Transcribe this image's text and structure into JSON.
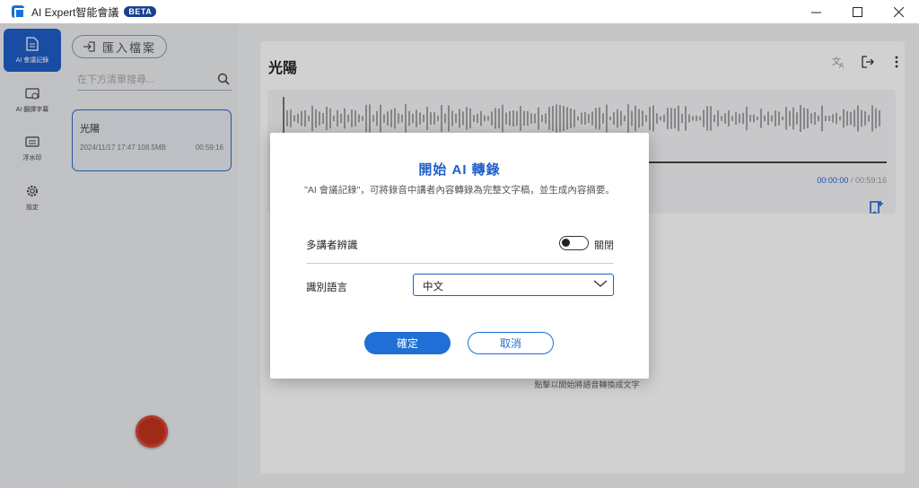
{
  "window": {
    "title": "AI Expert智能會議",
    "badge": "BETA"
  },
  "nav": {
    "items": [
      {
        "label": "AI 會議記錄",
        "icon": "document-icon",
        "active": true
      },
      {
        "label": "AI 翻譯字幕",
        "icon": "subtitle-screen-icon",
        "active": false
      },
      {
        "label": "浮水印",
        "icon": "watermark-icon",
        "active": false
      },
      {
        "label": "設定",
        "icon": "gear-icon",
        "active": false
      }
    ]
  },
  "list": {
    "import_label": "匯入檔案",
    "search_placeholder": "在下方清單搜尋...",
    "records": [
      {
        "name": "光陽",
        "datetime": "2024/11/17 17:47",
        "size": "108.5MB",
        "duration": "00:59:16"
      }
    ]
  },
  "main": {
    "title": "光陽",
    "time_current": "00:00:00",
    "time_separator": "/",
    "time_total": "00:59:16",
    "hint": "點擊以開始將語音轉換成文字"
  },
  "dialog": {
    "title": "開始 AI 轉錄",
    "description": "\"AI 會議記錄\"，可將錄音中講者內容轉錄為完整文字稿，並生成內容摘要。",
    "speaker_label": "多講者辨識",
    "speaker_toggle_state": "關閉",
    "language_label": "識別語言",
    "language_value": "中文",
    "ok_label": "確定",
    "cancel_label": "取消"
  },
  "colors": {
    "accent": "#1f5fc9",
    "record_button": "#c4321f"
  }
}
